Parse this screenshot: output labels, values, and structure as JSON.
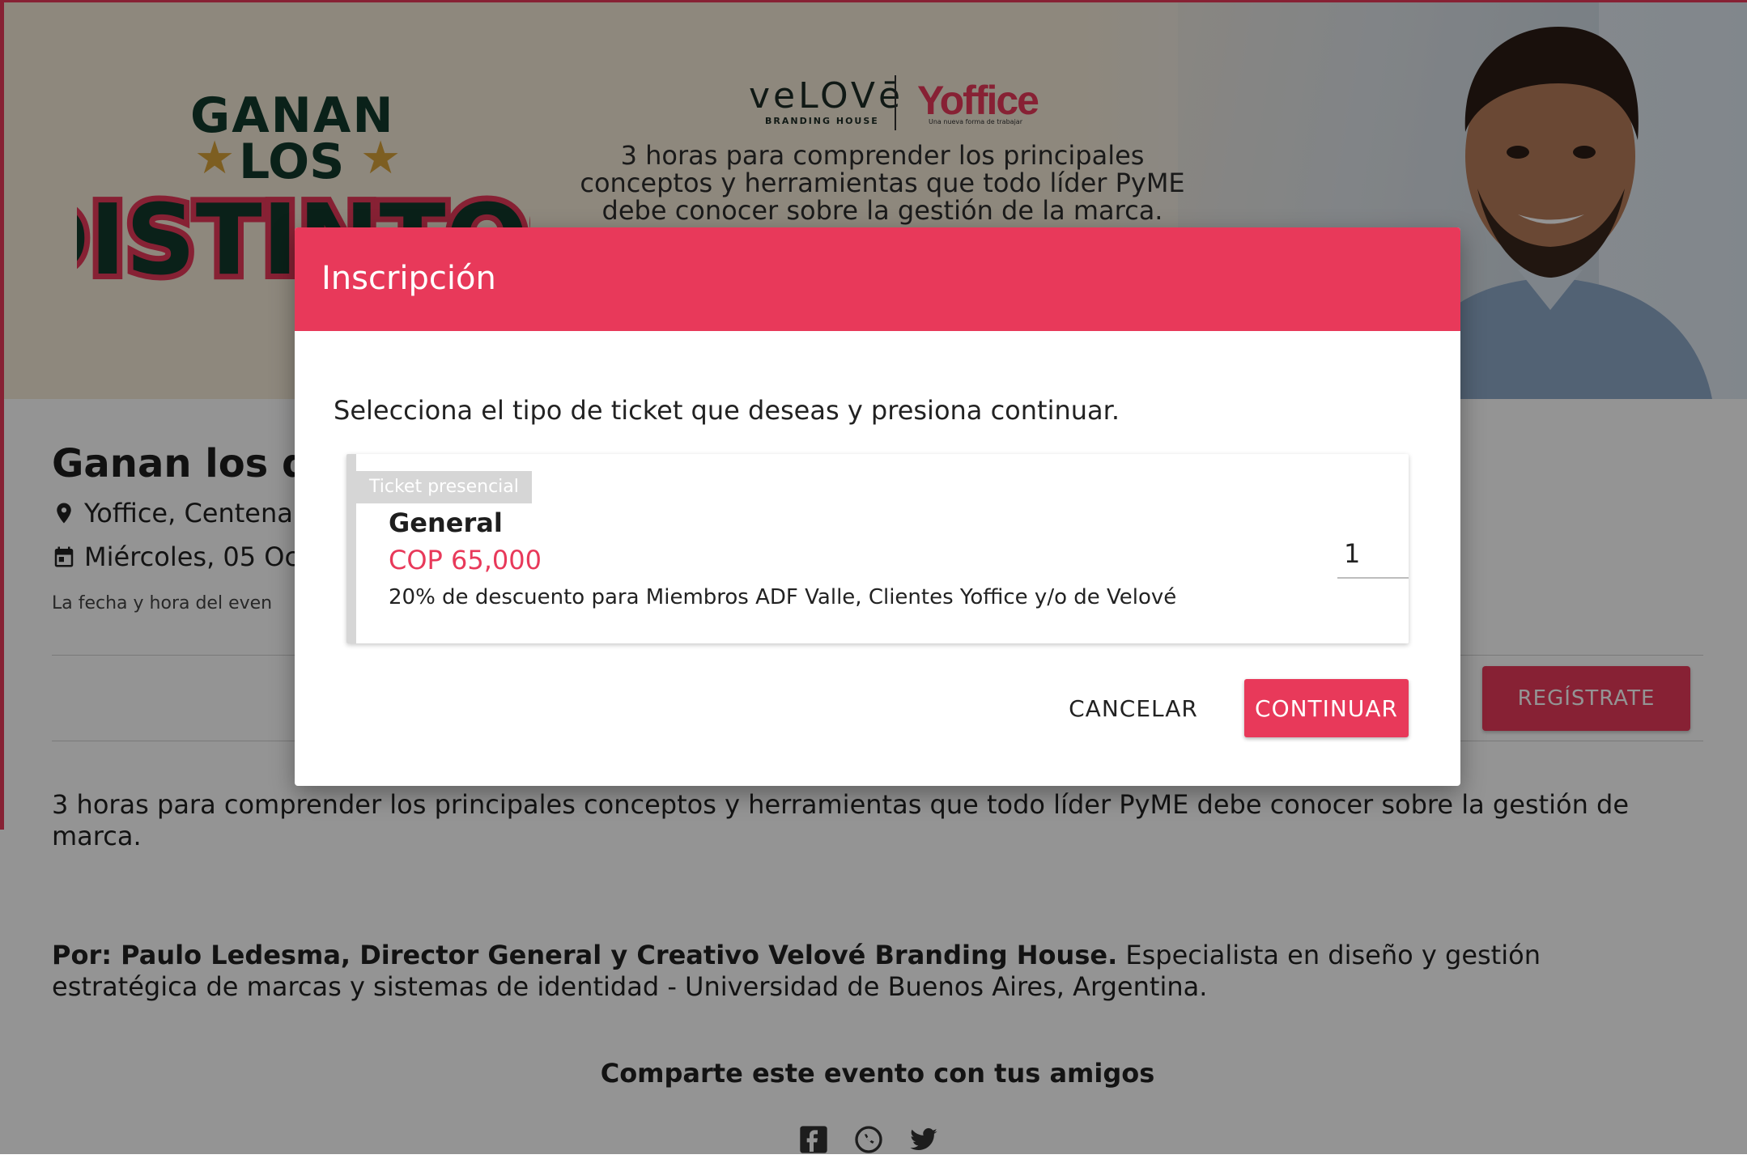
{
  "banner": {
    "line1": "GANAN",
    "line2": "LOS",
    "line3": "DISTINTOS",
    "logo_left": "veLOVē",
    "logo_left_sub": "BRANDING HOUSE",
    "logo_right": "Yoffice",
    "logo_right_sub": "Una nueva forma de trabajar",
    "tagline": "3 horas para comprender los principales conceptos y herramientas que todo líder PyME debe conocer sobre la gestión de la marca."
  },
  "event": {
    "title": "Ganan los d",
    "location": "Yoffice, Centenar",
    "date": "Miércoles, 05 Oc",
    "timezone_note": "La fecha y hora del even",
    "register_label": "REGÍSTRATE",
    "description": "3 horas para comprender los principales conceptos y herramientas que todo líder PyME debe conocer sobre la gestión de marca.",
    "speaker_bold": "Por: Paulo Ledesma, Director General y Creativo Velové Branding House.",
    "speaker_rest": " Especialista en diseño y gestión estratégica de marcas y sistemas de identidad - Universidad de Buenos Aires, Argentina.",
    "share_title": "Comparte este evento con tus amigos",
    "share_icons": [
      "facebook-icon",
      "whatsapp-icon",
      "twitter-icon"
    ]
  },
  "dialog": {
    "title": "Inscripción",
    "instructions": "Selecciona el tipo de ticket que deseas y presiona continuar.",
    "ticket": {
      "badge": "Ticket presencial",
      "name": "General",
      "price": "COP 65,000",
      "discount": "20% de descuento para Miembros ADF Valle, Clientes Yoffice y/o de Velové",
      "quantity": "1"
    },
    "cancel_label": "CANCELAR",
    "continue_label": "CONTINUAR"
  },
  "colors": {
    "accent": "#e8395a",
    "overlay": "rgba(0,0,0,0.42)",
    "badge_gray": "#d6d6d6"
  }
}
